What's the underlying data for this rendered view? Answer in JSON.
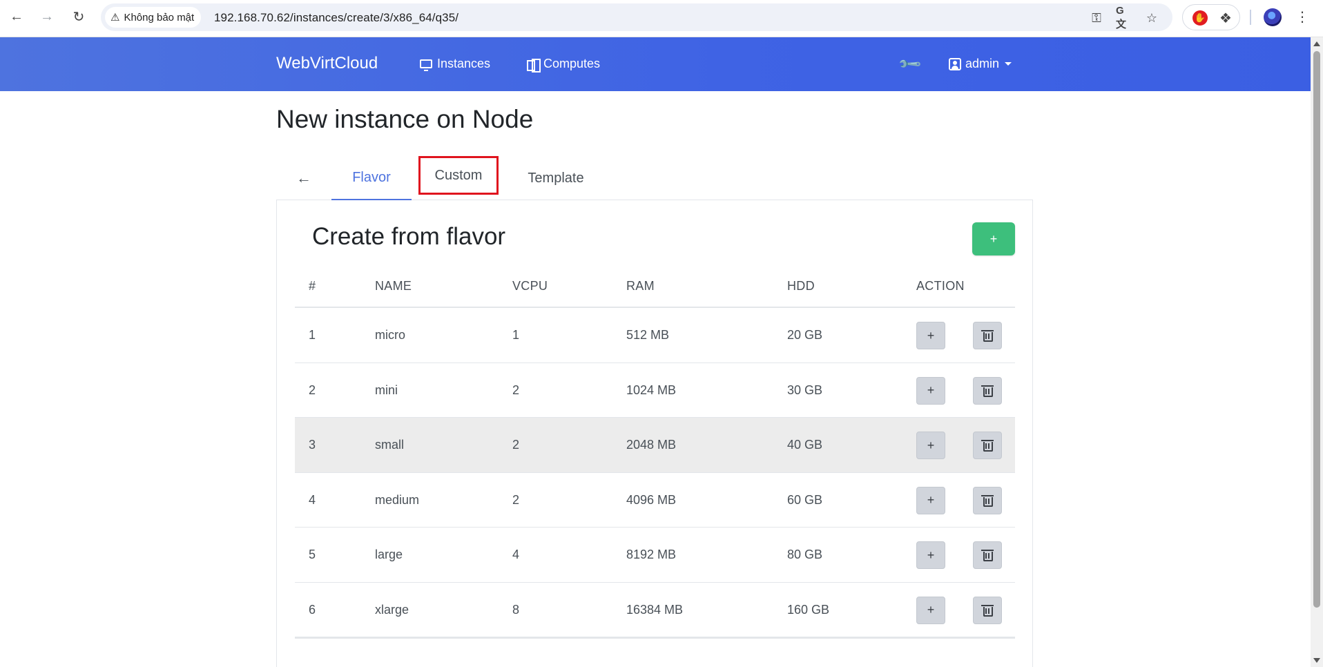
{
  "browser": {
    "security_label": "Không bảo mật",
    "url": "192.168.70.62/instances/create/3/x86_64/q35/",
    "icons": [
      "back-arrow-icon",
      "forward-arrow-icon",
      "reload-icon",
      "warning-icon",
      "password-key-icon",
      "translate-icon",
      "star-icon",
      "stop-extension-icon",
      "extensions-puzzle-icon",
      "profile-avatar-icon",
      "more-menu-icon"
    ]
  },
  "navbar": {
    "brand": "WebVirtCloud",
    "instances_label": "Instances",
    "computes_label": "Computes",
    "user_label": "admin",
    "color": "#4e73df"
  },
  "page": {
    "title": "New instance on Node"
  },
  "tabs": {
    "back_label": "←",
    "items": [
      {
        "label": "Flavor",
        "active": true
      },
      {
        "label": "Custom",
        "active": false
      },
      {
        "label": "Template",
        "active": false
      }
    ]
  },
  "card": {
    "title": "Create from flavor",
    "add_label": "+",
    "add_color": "#3dbf7c"
  },
  "table": {
    "headers": [
      "#",
      "NAME",
      "VCPU",
      "RAM",
      "HDD",
      "ACTION"
    ],
    "rows": [
      {
        "num": "1",
        "name": "micro",
        "vcpu": "1",
        "ram": "512 MB",
        "hdd": "20 GB"
      },
      {
        "num": "2",
        "name": "mini",
        "vcpu": "2",
        "ram": "1024 MB",
        "hdd": "30 GB"
      },
      {
        "num": "3",
        "name": "small",
        "vcpu": "2",
        "ram": "2048 MB",
        "hdd": "40 GB"
      },
      {
        "num": "4",
        "name": "medium",
        "vcpu": "2",
        "ram": "4096 MB",
        "hdd": "60 GB"
      },
      {
        "num": "5",
        "name": "large",
        "vcpu": "4",
        "ram": "8192 MB",
        "hdd": "80 GB"
      },
      {
        "num": "6",
        "name": "xlarge",
        "vcpu": "8",
        "ram": "16384 MB",
        "hdd": "160 GB"
      }
    ],
    "action_add_label": "+"
  }
}
